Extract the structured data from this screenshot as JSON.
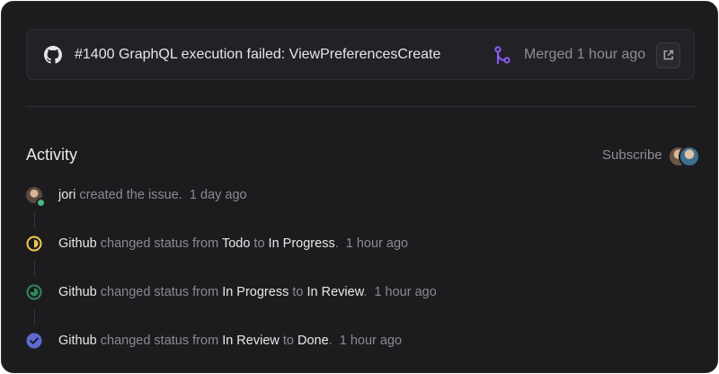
{
  "pull_request": {
    "title": "#1400 GraphQL execution failed: ViewPreferencesCreate",
    "status": "Merged 1 hour ago"
  },
  "activity": {
    "heading": "Activity",
    "subscribe_label": "Subscribe"
  },
  "events": [
    {
      "actor": "jori",
      "verb": "created the issue.",
      "time": "1 day ago"
    },
    {
      "actor": "Github",
      "verb": "changed status from",
      "from": "Todo",
      "to_word": "to",
      "to": "In Progress",
      "time": "1 hour ago"
    },
    {
      "actor": "Github",
      "verb": "changed status from",
      "from": "In Progress",
      "to_word": "to",
      "to": "In Review",
      "time": "1 hour ago"
    },
    {
      "actor": "Github",
      "verb": "changed status from",
      "from": "In Review",
      "to_word": "to",
      "to": "Done",
      "time": "1 hour ago"
    }
  ],
  "icons": {
    "repo": "github-icon",
    "merge": "merge-icon",
    "external": "external-link-icon",
    "in_progress": "in-progress-status-icon",
    "in_review": "in-review-status-icon",
    "done": "done-status-icon"
  },
  "colors": {
    "background": "#1c1c1f",
    "card": "#222226",
    "merge_purple": "#8b5cf6",
    "in_progress": "#f2c94c",
    "in_review": "#2e8b57",
    "done": "#5e6ad2",
    "presence": "#4cb782"
  }
}
